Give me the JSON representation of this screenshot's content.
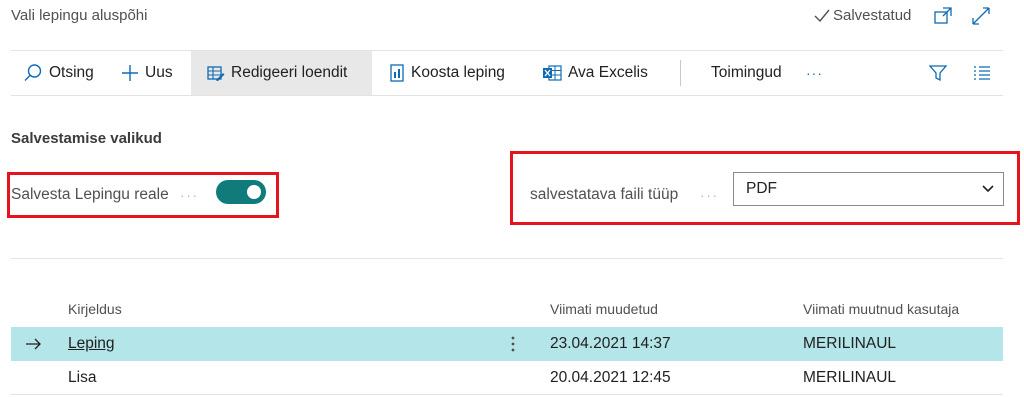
{
  "page": {
    "title": "Vali lepingu aluspõhi",
    "saved_status": "Salvestatud"
  },
  "toolbar": {
    "search": "Otsing",
    "new": "Uus",
    "edit_list": "Redigeeri loendit",
    "compose_contract": "Koosta leping",
    "open_excel": "Ava Excelis",
    "actions": "Toimingud",
    "more": "···"
  },
  "options": {
    "section_title": "Salvestamise valikud",
    "save_to_line_label": "Salvesta Lepingu reale",
    "save_to_line_value": true,
    "file_type_label": "salvestatava faili tüüp",
    "file_type_value": "PDF",
    "label_dots": "···"
  },
  "table": {
    "columns": [
      "Kirjeldus",
      "Viimati muudetud",
      "Viimati muutnud kasutaja"
    ],
    "rows": [
      {
        "description": "Leping",
        "modified": "23.04.2021 14:37",
        "user": "MERILINAUL",
        "selected": true
      },
      {
        "description": "Lisa",
        "modified": "20.04.2021 12:45",
        "user": "MERILINAUL",
        "selected": false
      }
    ]
  },
  "colors": {
    "accent": "#0f7b7b",
    "selected_row": "#b3e5e9",
    "highlight_box": "#e5131d"
  }
}
